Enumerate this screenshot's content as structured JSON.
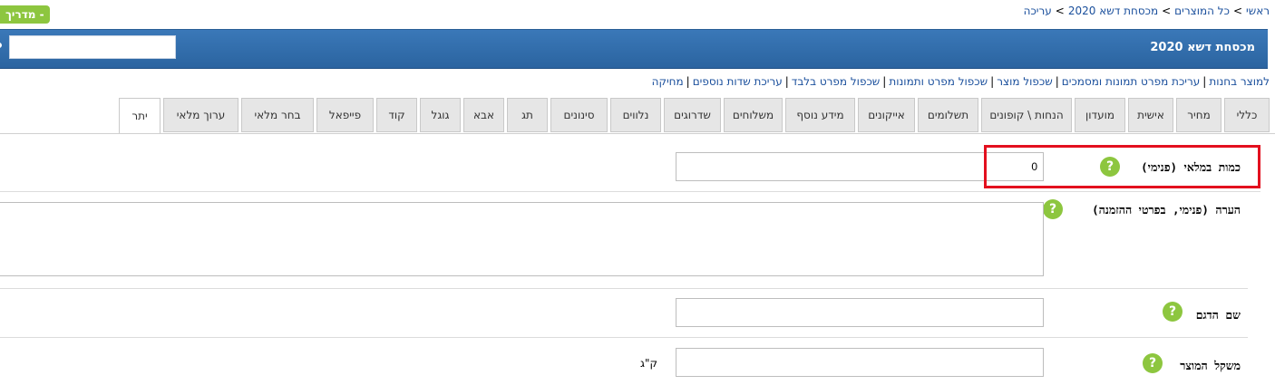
{
  "breadcrumb": {
    "items": [
      "ראשי",
      "כל המוצרים",
      "מכסחת דשא 2020",
      "עריכה"
    ],
    "separator": ">"
  },
  "guide_button": {
    "label": "מדריך -"
  },
  "header": {
    "title": "מכסחת דשא 2020",
    "search_value": ""
  },
  "action_links": [
    "למוצר בחנות",
    "עריכת מפרט תמונות ומסמכים",
    "שכפול מוצר",
    "שכפול מפרט ותמונות",
    "שכפול מפרט בלבד",
    "עריכת שדות נוספים",
    "מחיקה"
  ],
  "tabs": [
    {
      "label": "כללי"
    },
    {
      "label": "מחיר"
    },
    {
      "label": "אישית"
    },
    {
      "label": "מועדון"
    },
    {
      "label": "הנחות \\ קופונים"
    },
    {
      "label": "תשלומים"
    },
    {
      "label": "אייקונים"
    },
    {
      "label": "מידע נוסף"
    },
    {
      "label": "משלוחים"
    },
    {
      "label": "שדרוגים"
    },
    {
      "label": "נלווים"
    },
    {
      "label": "סינונים"
    },
    {
      "label": "תג"
    },
    {
      "label": "אבא"
    },
    {
      "label": "גוגל"
    },
    {
      "label": "קוד"
    },
    {
      "label": "פייפאל"
    },
    {
      "label": "בחר מלאי"
    },
    {
      "label": "ערוך מלאי"
    },
    {
      "label": "יתר",
      "active": true
    }
  ],
  "fields": {
    "stock_qty": {
      "label": "כמות במלאי (פנימי)",
      "value": "0"
    },
    "note": {
      "label": "הערה (פנימי, בפרטי ההזמנה)",
      "value": ""
    },
    "model_name": {
      "label": "שם הדגם",
      "value": ""
    },
    "weight": {
      "label": "משקל המוצר",
      "value": "",
      "unit": "ק\"ג"
    }
  },
  "help_icon_glyph": "?",
  "colors": {
    "header": "#2f6ba9",
    "help": "#8dc63f",
    "link": "#1a4f9c",
    "highlight": "#e3101e"
  }
}
